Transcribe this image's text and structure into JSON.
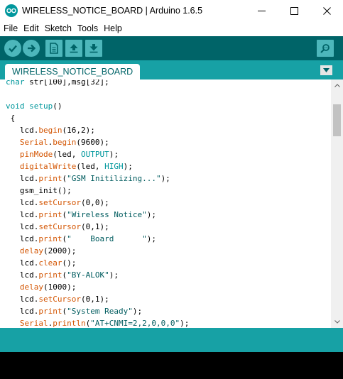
{
  "window": {
    "title": "WIRELESS_NOTICE_BOARD | Arduino 1.6.5"
  },
  "menu": [
    "File",
    "Edit",
    "Sketch",
    "Tools",
    "Help"
  ],
  "toolbar": {
    "buttons": [
      "verify-icon",
      "upload-icon",
      "new-icon",
      "open-icon",
      "save-icon",
      "serial-monitor-icon"
    ]
  },
  "tabs": [
    {
      "label": "WIRELESS_NOTICE_BOARD"
    }
  ],
  "colors": {
    "toolbar": "#006468",
    "tabbar": "#17a1a5",
    "function": "#d35400",
    "keyword": "#00979c",
    "string": "#005c5f"
  },
  "code": [
    [
      {
        "t": "char",
        "c": "ty"
      },
      {
        "t": " str[100],msg[32];"
      }
    ],
    [],
    [
      {
        "t": "void",
        "c": "ty"
      },
      {
        "t": " "
      },
      {
        "t": "setup",
        "c": "kw"
      },
      {
        "t": "()"
      }
    ],
    [
      {
        "t": " {"
      }
    ],
    [
      {
        "t": "   lcd."
      },
      {
        "t": "begin",
        "c": "fn"
      },
      {
        "t": "(16,2);"
      }
    ],
    [
      {
        "t": "   "
      },
      {
        "t": "Serial",
        "c": "fn"
      },
      {
        "t": "."
      },
      {
        "t": "begin",
        "c": "fn"
      },
      {
        "t": "(9600);"
      }
    ],
    [
      {
        "t": "   "
      },
      {
        "t": "pinMode",
        "c": "fn"
      },
      {
        "t": "(led, "
      },
      {
        "t": "OUTPUT",
        "c": "kw"
      },
      {
        "t": ");"
      }
    ],
    [
      {
        "t": "   "
      },
      {
        "t": "digitalWrite",
        "c": "fn"
      },
      {
        "t": "(led, "
      },
      {
        "t": "HIGH",
        "c": "kw"
      },
      {
        "t": ");"
      }
    ],
    [
      {
        "t": "   lcd."
      },
      {
        "t": "print",
        "c": "fn"
      },
      {
        "t": "("
      },
      {
        "t": "\"GSM Initilizing...\"",
        "c": "str"
      },
      {
        "t": ");"
      }
    ],
    [
      {
        "t": "   gsm_init();"
      }
    ],
    [
      {
        "t": "   lcd."
      },
      {
        "t": "setCursor",
        "c": "fn"
      },
      {
        "t": "(0,0);"
      }
    ],
    [
      {
        "t": "   lcd."
      },
      {
        "t": "print",
        "c": "fn"
      },
      {
        "t": "("
      },
      {
        "t": "\"Wireless Notice\"",
        "c": "str"
      },
      {
        "t": ");"
      }
    ],
    [
      {
        "t": "   lcd."
      },
      {
        "t": "setCursor",
        "c": "fn"
      },
      {
        "t": "(0,1);"
      }
    ],
    [
      {
        "t": "   lcd."
      },
      {
        "t": "print",
        "c": "fn"
      },
      {
        "t": "("
      },
      {
        "t": "\"    Board      \"",
        "c": "str"
      },
      {
        "t": ");"
      }
    ],
    [
      {
        "t": "   "
      },
      {
        "t": "delay",
        "c": "fn"
      },
      {
        "t": "(2000);"
      }
    ],
    [
      {
        "t": "   lcd."
      },
      {
        "t": "clear",
        "c": "fn"
      },
      {
        "t": "();"
      }
    ],
    [
      {
        "t": "   lcd."
      },
      {
        "t": "print",
        "c": "fn"
      },
      {
        "t": "("
      },
      {
        "t": "\"BY-ALOK\"",
        "c": "str"
      },
      {
        "t": ");"
      }
    ],
    [
      {
        "t": "   "
      },
      {
        "t": "delay",
        "c": "fn"
      },
      {
        "t": "(1000);"
      }
    ],
    [
      {
        "t": "   lcd."
      },
      {
        "t": "setCursor",
        "c": "fn"
      },
      {
        "t": "(0,1);"
      }
    ],
    [
      {
        "t": "   lcd."
      },
      {
        "t": "print",
        "c": "fn"
      },
      {
        "t": "("
      },
      {
        "t": "\"System Ready\"",
        "c": "str"
      },
      {
        "t": ");"
      }
    ],
    [
      {
        "t": "   "
      },
      {
        "t": "Serial",
        "c": "fn"
      },
      {
        "t": "."
      },
      {
        "t": "println",
        "c": "fn"
      },
      {
        "t": "("
      },
      {
        "t": "\"AT+CNMI=2,2,0,0,0\"",
        "c": "str"
      },
      {
        "t": ");"
      }
    ]
  ]
}
